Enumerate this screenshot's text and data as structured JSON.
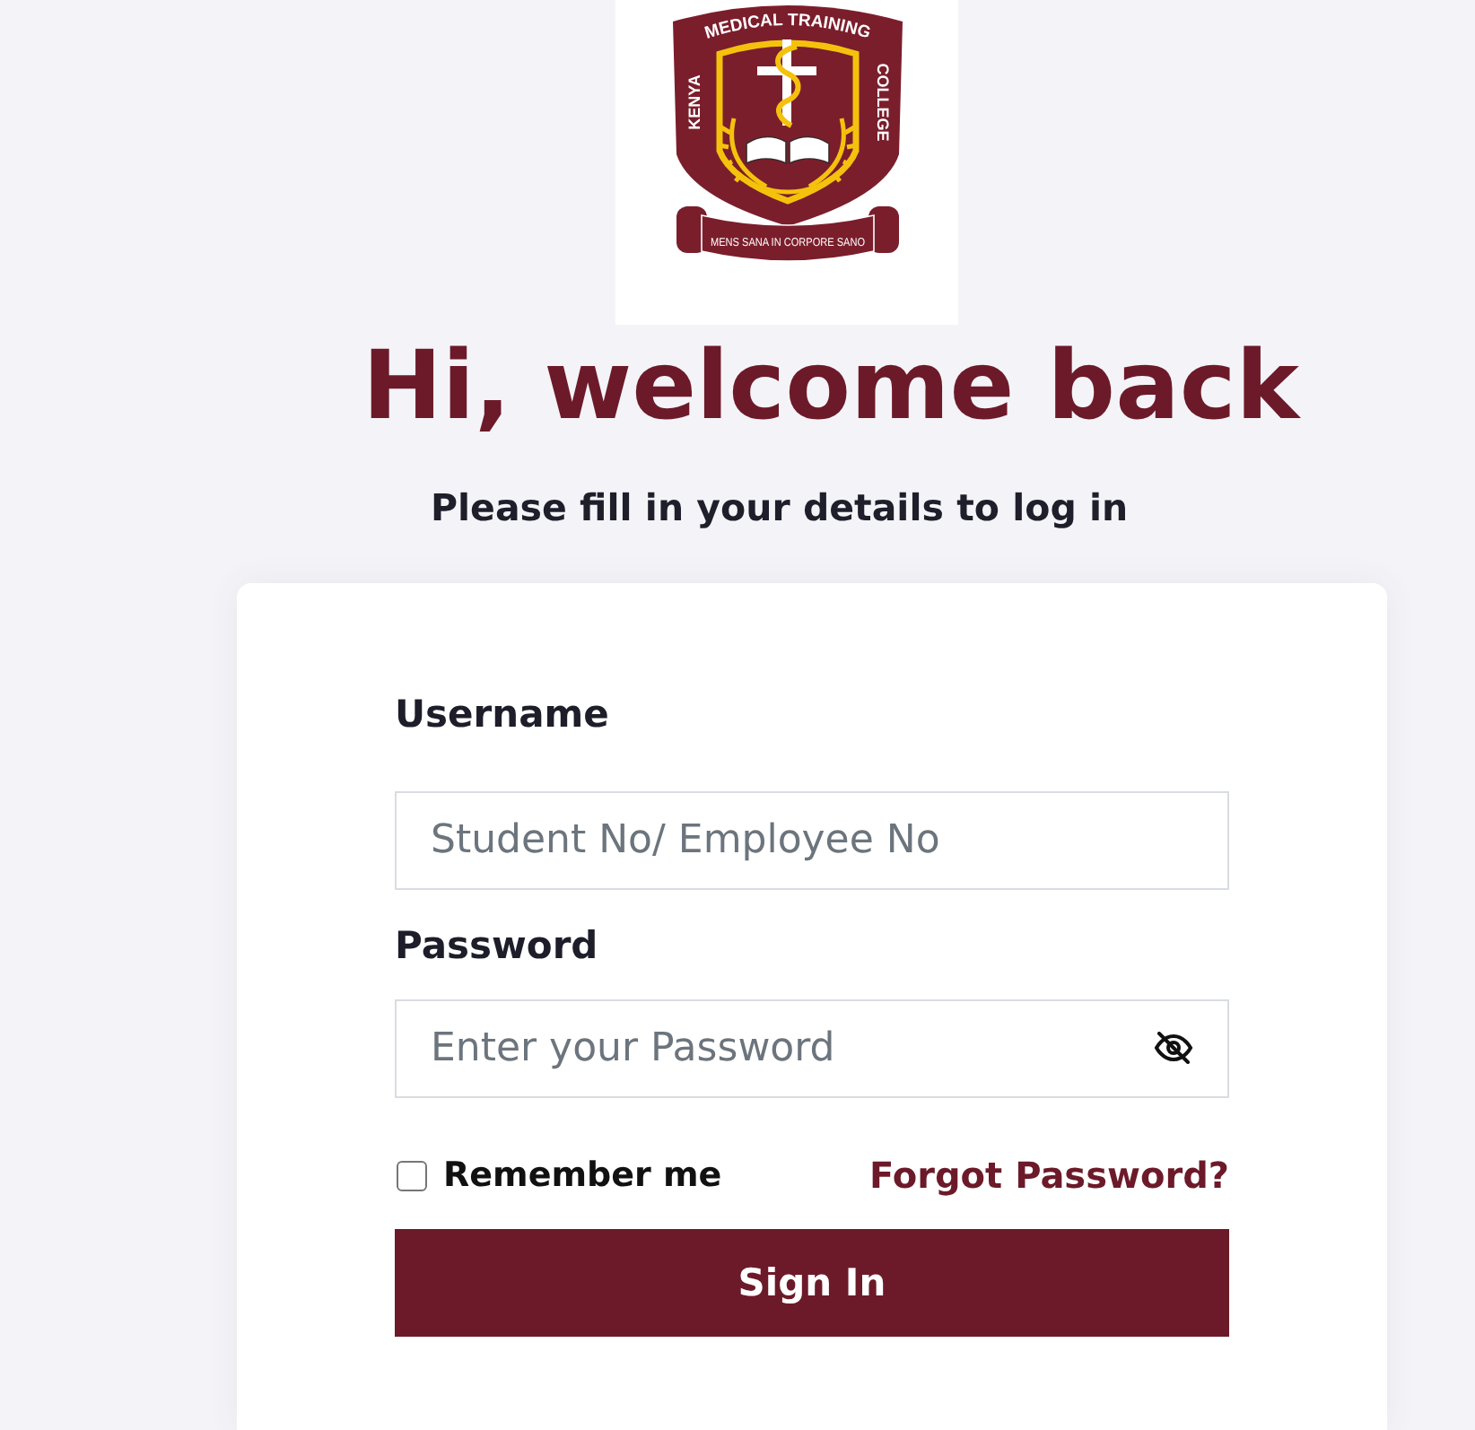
{
  "logo": {
    "arc_text": "MEDICAL TRAINING",
    "left_text": "KENYA",
    "right_text": "COLLEGE",
    "motto": "MENS SANA IN CORPORE SANO"
  },
  "heading": "Hi, welcome back",
  "subheading": "Please fill in your details to log in",
  "form": {
    "username": {
      "label": "Username",
      "placeholder": "Student No/ Employee No"
    },
    "password": {
      "label": "Password",
      "placeholder": "Enter your Password",
      "visible": false
    },
    "remember": {
      "label": "Remember me",
      "checked": false
    },
    "forgot_link": "Forgot Password?",
    "submit": "Sign In"
  }
}
